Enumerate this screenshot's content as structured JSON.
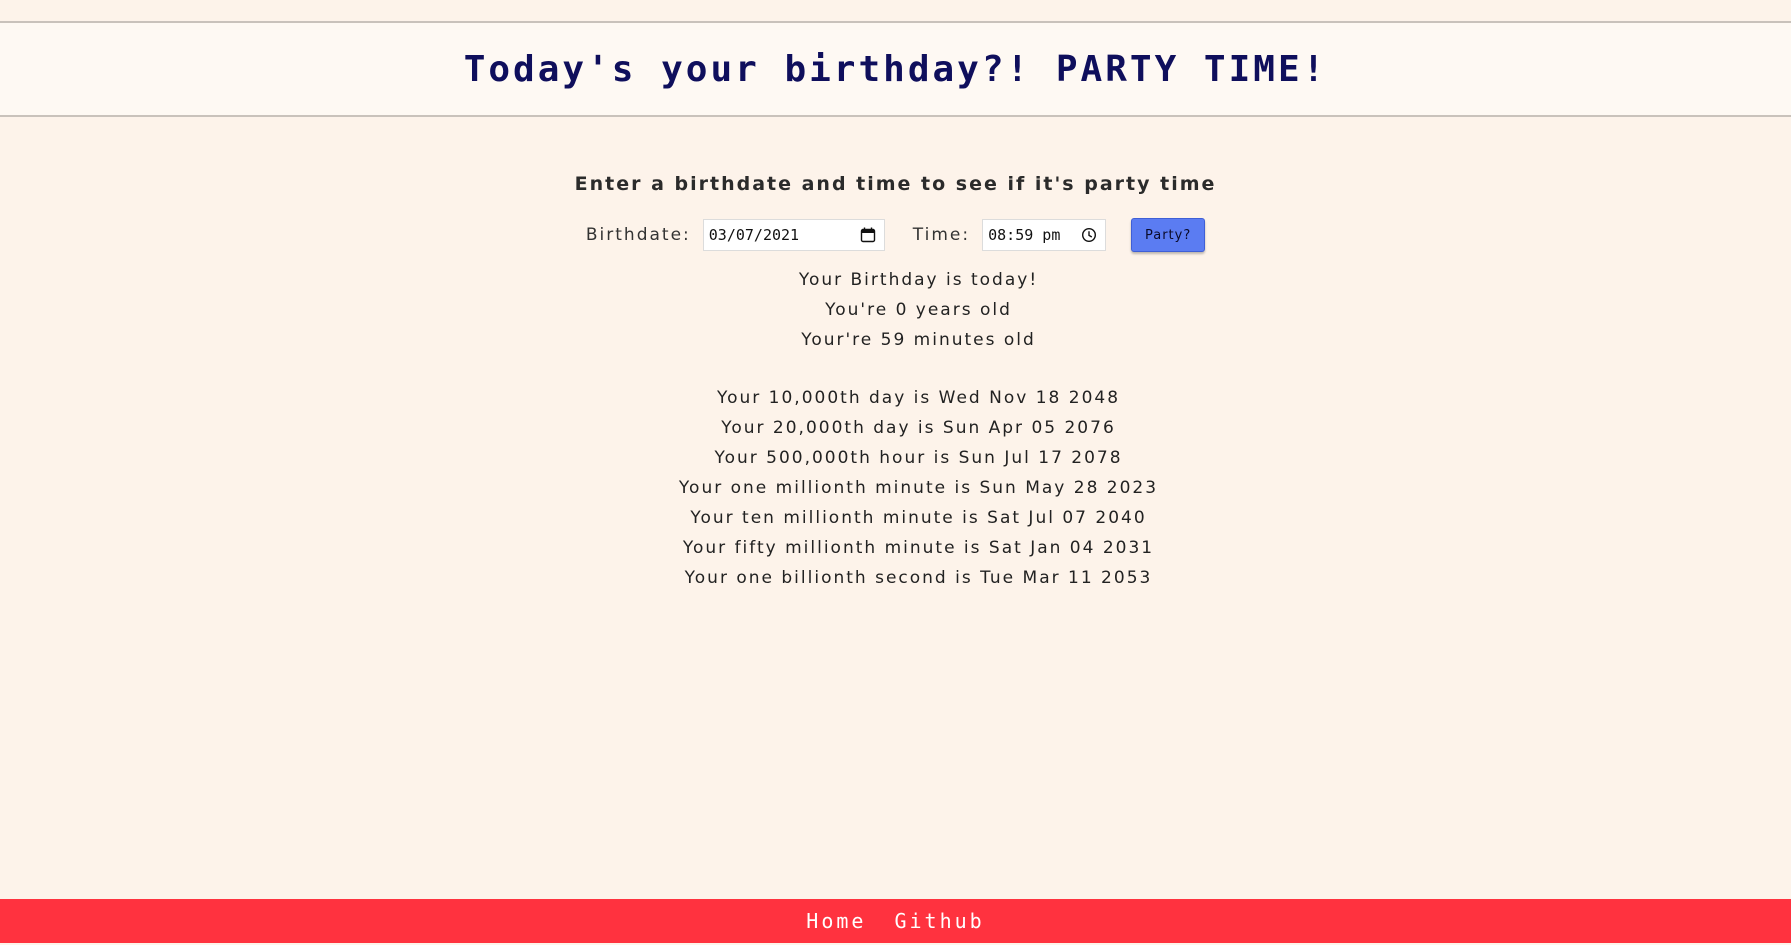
{
  "header": {
    "title": "Today's your birthday?! PARTY TIME!"
  },
  "form": {
    "instruction": "Enter a birthdate and time to see if it's party time",
    "birthdate_label": "Birthdate:",
    "birthdate_value": "03/07/2021",
    "time_label": "Time:",
    "time_value": "08:59 pm",
    "submit_label": "Party?",
    "icons": {
      "date": "calendar-icon",
      "time": "clock-icon"
    }
  },
  "results": {
    "birthday_status": "Your Birthday is today!",
    "years_old": "You're 0 years old",
    "minutes_old": "Your're 59 minutes old",
    "milestones": [
      "Your 10,000th day is Wed Nov 18 2048",
      "Your 20,000th day is Sun Apr 05 2076",
      "Your 500,000th hour is Sun Jul 17 2078",
      "Your one millionth minute is Sun May 28 2023",
      "Your ten millionth minute is Sat Jul 07 2040",
      "Your fifty millionth minute is Sat Jan 04 2031",
      "Your one billionth second is Tue Mar 11 2053"
    ]
  },
  "footer": {
    "links": [
      "Home",
      "Github"
    ]
  },
  "colors": {
    "background": "#fdf3ea",
    "header_background": "#fef9f3",
    "title": "#0f0f5c",
    "button": "#5b7cf2",
    "footer": "#ff323f"
  }
}
